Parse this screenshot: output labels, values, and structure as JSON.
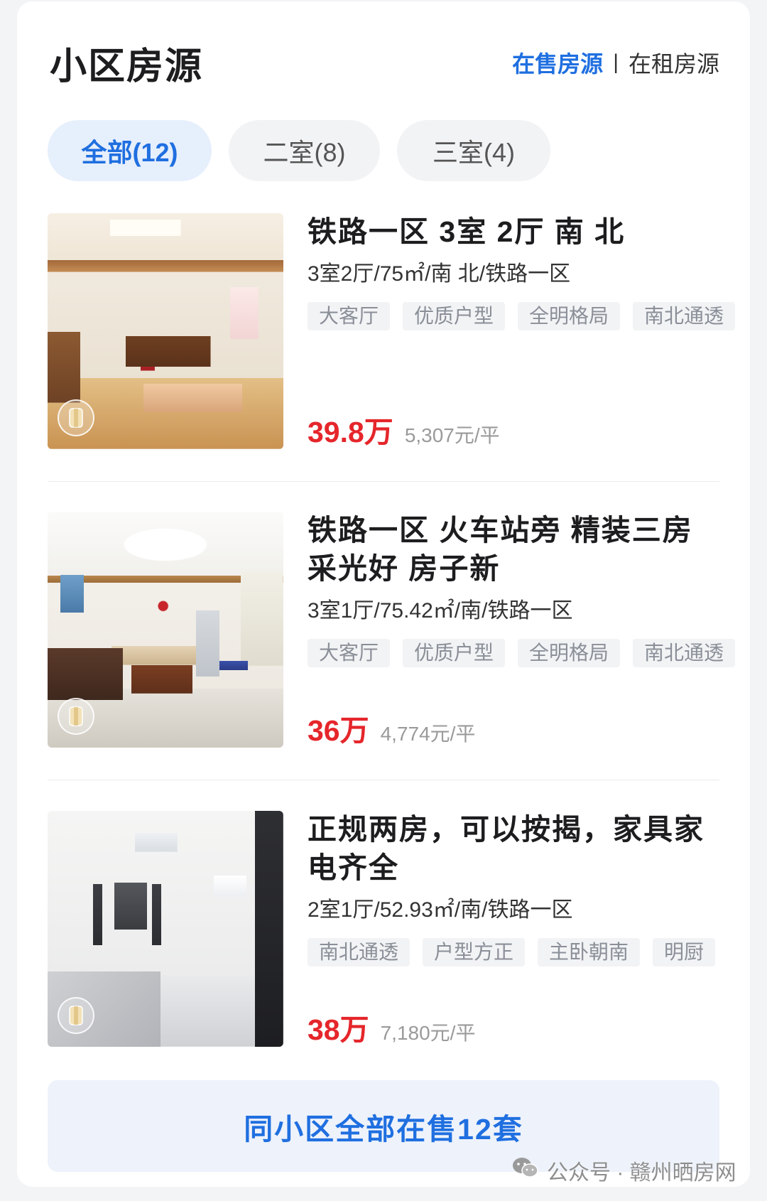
{
  "header": {
    "title": "小区房源",
    "tab_sale": "在售房源",
    "separator": "|",
    "tab_rent": "在租房源"
  },
  "filters": [
    {
      "label": "全部(12)",
      "active": true
    },
    {
      "label": "二室(8)",
      "active": false
    },
    {
      "label": "三室(4)",
      "active": false
    }
  ],
  "listings": [
    {
      "title": "铁路一区 3室 2厅 南 北",
      "summary": "3室2厅/75㎡/南 北/铁路一区",
      "tags": [
        "大客厅",
        "优质户型",
        "全明格局",
        "南北通透"
      ],
      "price": "39.8万",
      "unit_price": "5,307元/平"
    },
    {
      "title": "铁路一区 火车站旁 精装三房 采光好 房子新",
      "summary": "3室1厅/75.42㎡/南/铁路一区",
      "tags": [
        "大客厅",
        "优质户型",
        "全明格局",
        "南北通透"
      ],
      "price": "36万",
      "unit_price": "4,774元/平"
    },
    {
      "title": "正规两房，可以按揭，家具家电齐全",
      "summary": "2室1厅/52.93㎡/南/铁路一区",
      "tags": [
        "南北通透",
        "户型方正",
        "主卧朝南",
        "明厨"
      ],
      "price": "38万",
      "unit_price": "7,180元/平"
    }
  ],
  "footer_button": "同小区全部在售12套",
  "watermark": "公众号 · 赣州晒房网",
  "icons": {
    "vr": "vr-icon",
    "wechat": "wechat-icon"
  },
  "colors": {
    "accent": "#1f6fe0",
    "price": "#e5262b"
  }
}
